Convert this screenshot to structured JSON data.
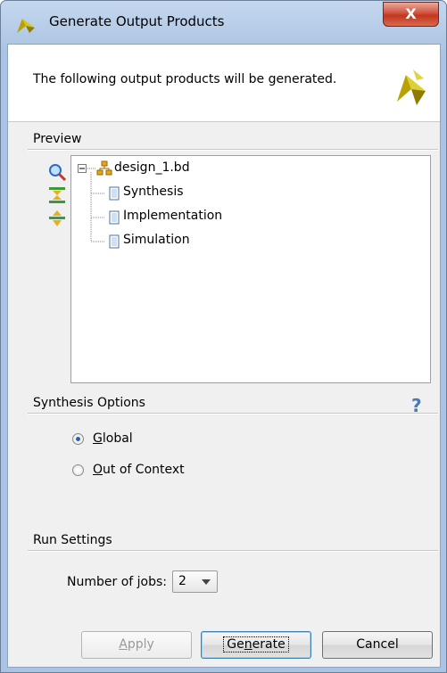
{
  "window": {
    "title": "Generate Output Products",
    "close_label": "X"
  },
  "header": {
    "message": "The following output products will be generated."
  },
  "preview": {
    "section_label": "Preview",
    "tree": {
      "root": "design_1.bd",
      "children": [
        "Synthesis",
        "Implementation",
        "Simulation"
      ]
    }
  },
  "synthesis_options": {
    "section_label": "Synthesis Options",
    "help_label": "?",
    "options": [
      {
        "label_prefix": "",
        "mnemonic": "G",
        "label_rest": "lobal",
        "selected": true
      },
      {
        "label_prefix": "",
        "mnemonic": "O",
        "label_rest": "ut of Context",
        "selected": false
      }
    ]
  },
  "run_settings": {
    "section_label": "Run Settings",
    "jobs_label_prefix": "Number of ",
    "jobs_mnemonic": "j",
    "jobs_label_rest": "obs:",
    "jobs_value": "2"
  },
  "buttons": {
    "apply_mnemonic": "A",
    "apply_rest": "pply",
    "generate_prefix": "Ge",
    "generate_mnemonic": "n",
    "generate_rest": "erate",
    "cancel": "Cancel"
  },
  "icons": {
    "title": "vivado-logo-icon",
    "header": "vivado-logo-icon",
    "search": "search-icon",
    "collapse": "collapse-all-icon",
    "expand": "expand-all-icon",
    "tree_toggle": "minus-box-icon",
    "hierarchy": "hierarchy-icon",
    "file": "file-icon"
  },
  "colors": {
    "titlebar": "#b7cde8",
    "close_button": "#c2361f",
    "accent_blue": "#2a5fb0",
    "vivado_yellow": "#c8b400"
  }
}
